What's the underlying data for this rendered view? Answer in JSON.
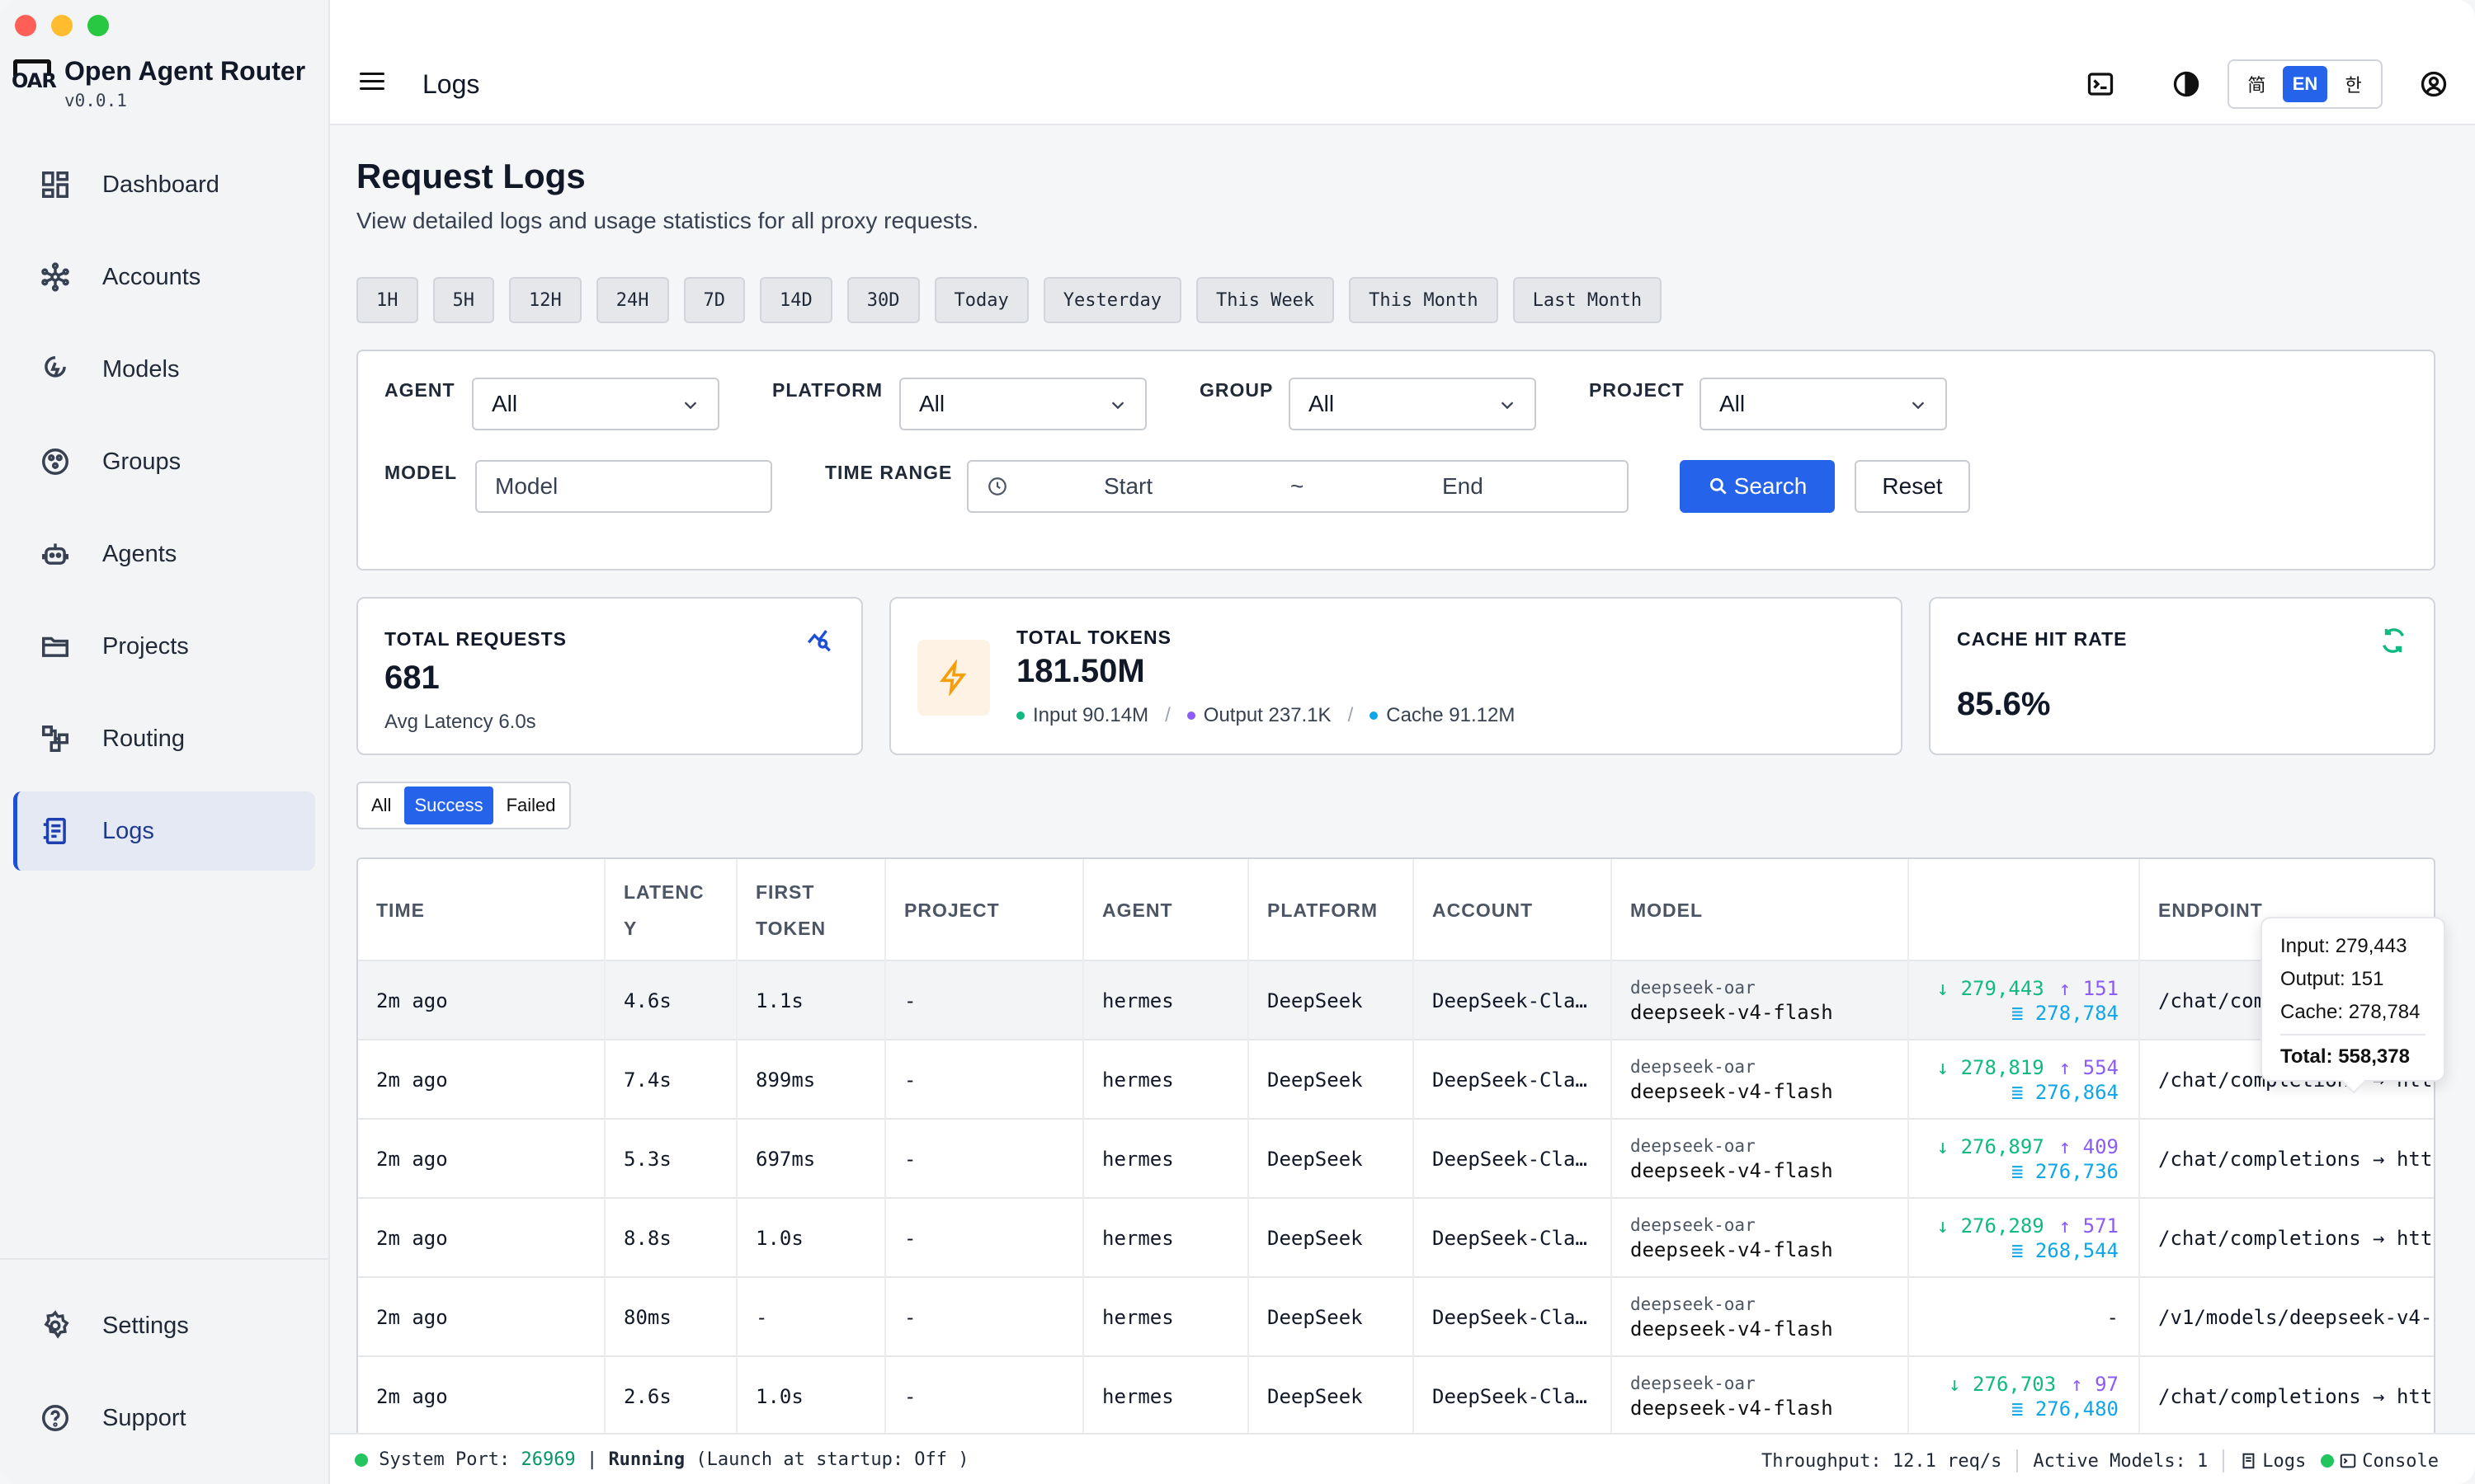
{
  "app": {
    "name": "Open Agent Router",
    "version": "v0.0.1",
    "logo_text": "OAR"
  },
  "sidebar": {
    "items": [
      {
        "label": "Dashboard",
        "icon": "dashboard-icon"
      },
      {
        "label": "Accounts",
        "icon": "network-icon"
      },
      {
        "label": "Models",
        "icon": "model-icon"
      },
      {
        "label": "Groups",
        "icon": "groups-icon"
      },
      {
        "label": "Agents",
        "icon": "robot-icon"
      },
      {
        "label": "Projects",
        "icon": "folder-icon"
      },
      {
        "label": "Routing",
        "icon": "routing-icon"
      },
      {
        "label": "Logs",
        "icon": "logs-icon",
        "active": true
      }
    ],
    "bottom": [
      {
        "label": "Settings",
        "icon": "gear-icon"
      },
      {
        "label": "Support",
        "icon": "help-icon"
      }
    ]
  },
  "header": {
    "title": "Logs",
    "lang": [
      "简",
      "EN",
      "한"
    ],
    "lang_selected": "EN"
  },
  "page": {
    "title": "Request Logs",
    "subtitle": "View detailed logs and usage statistics for all proxy requests.",
    "quick_ranges": [
      "1H",
      "5H",
      "12H",
      "24H",
      "7D",
      "14D",
      "30D",
      "Today",
      "Yesterday",
      "This Week",
      "This Month",
      "Last Month"
    ]
  },
  "filters": {
    "agent_label": "AGENT",
    "agent_value": "All",
    "platform_label": "PLATFORM",
    "platform_value": "All",
    "group_label": "GROUP",
    "group_value": "All",
    "project_label": "PROJECT",
    "project_value": "All",
    "model_label": "MODEL",
    "model_placeholder": "Model",
    "time_label": "TIME RANGE",
    "time_start": "Start",
    "time_sep": "~",
    "time_end": "End",
    "search_label": "Search",
    "reset_label": "Reset"
  },
  "stats": {
    "requests": {
      "label": "TOTAL REQUESTS",
      "value": "681",
      "sub": "Avg Latency 6.0s"
    },
    "tokens": {
      "label": "TOTAL TOKENS",
      "value": "181.50M",
      "input": "Input 90.14M",
      "output": "Output 237.1K",
      "cache": "Cache 91.12M",
      "sep": "/"
    },
    "cache": {
      "label": "CACHE HIT RATE",
      "value": "85.6%"
    }
  },
  "status_tabs": [
    "All",
    "Success",
    "Failed"
  ],
  "status_tab_selected": "Success",
  "table": {
    "columns": [
      "TIME",
      "LATENC Y",
      "FIRST TOKEN",
      "PROJECT",
      "AGENT",
      "PLATFORM",
      "ACCOUNT",
      "MODEL",
      "",
      "ENDPOINT"
    ],
    "rows": [
      {
        "time": "2m ago",
        "latency": "4.6s",
        "first": "1.1s",
        "project": "-",
        "agent": "hermes",
        "platform": "DeepSeek",
        "account": "DeepSeek-Cla…",
        "model_a": "deepseek-oar",
        "model_b": "deepseek-v4-flash",
        "in": "↓ 279,443",
        "out": "↑ 151",
        "cache": "278,784",
        "endpoint": "/chat/completions → htt"
      },
      {
        "time": "2m ago",
        "latency": "7.4s",
        "first": "899ms",
        "project": "-",
        "agent": "hermes",
        "platform": "DeepSeek",
        "account": "DeepSeek-Cla…",
        "model_a": "deepseek-oar",
        "model_b": "deepseek-v4-flash",
        "in": "↓ 278,819",
        "out": "↑ 554",
        "cache": "276,864",
        "endpoint": "/chat/completions → htt"
      },
      {
        "time": "2m ago",
        "latency": "5.3s",
        "first": "697ms",
        "project": "-",
        "agent": "hermes",
        "platform": "DeepSeek",
        "account": "DeepSeek-Cla…",
        "model_a": "deepseek-oar",
        "model_b": "deepseek-v4-flash",
        "in": "↓ 276,897",
        "out": "↑ 409",
        "cache": "276,736",
        "endpoint": "/chat/completions → htt"
      },
      {
        "time": "2m ago",
        "latency": "8.8s",
        "first": "1.0s",
        "project": "-",
        "agent": "hermes",
        "platform": "DeepSeek",
        "account": "DeepSeek-Cla…",
        "model_a": "deepseek-oar",
        "model_b": "deepseek-v4-flash",
        "in": "↓ 276,289",
        "out": "↑ 571",
        "cache": "268,544",
        "endpoint": "/chat/completions → htt"
      },
      {
        "time": "2m ago",
        "latency": "80ms",
        "first": "-",
        "project": "-",
        "agent": "hermes",
        "platform": "DeepSeek",
        "account": "DeepSeek-Cla…",
        "model_a": "deepseek-oar",
        "model_b": "deepseek-v4-flash",
        "in": "",
        "out": "",
        "cache": "",
        "dash": "-",
        "endpoint": "/v1/models/deepseek-v4-"
      },
      {
        "time": "2m ago",
        "latency": "2.6s",
        "first": "1.0s",
        "project": "-",
        "agent": "hermes",
        "platform": "DeepSeek",
        "account": "DeepSeek-Cla…",
        "model_a": "deepseek-oar",
        "model_b": "deepseek-v4-flash",
        "in": "↓ 276,703",
        "out": "↑ 97",
        "cache": "276,480",
        "endpoint": "/chat/completions → htt"
      }
    ]
  },
  "tooltip": {
    "input": "Input: 279,443",
    "output": "Output: 151",
    "cache": "Cache: 278,784",
    "total": "Total: 558,378"
  },
  "statusbar": {
    "port_label": "System Port:",
    "port": "26969",
    "sep": "|",
    "running": "Running",
    "startup": "(Launch at startup: Off )",
    "throughput": "Throughput: 12.1 req/s",
    "active_models": "Active Models: 1",
    "logs": "Logs",
    "console": "Console"
  },
  "colors": {
    "accent": "#2563eb",
    "input": "#10b981",
    "output": "#8b5cf6",
    "cache": "#0ea5e9",
    "running": "#22c55e"
  }
}
